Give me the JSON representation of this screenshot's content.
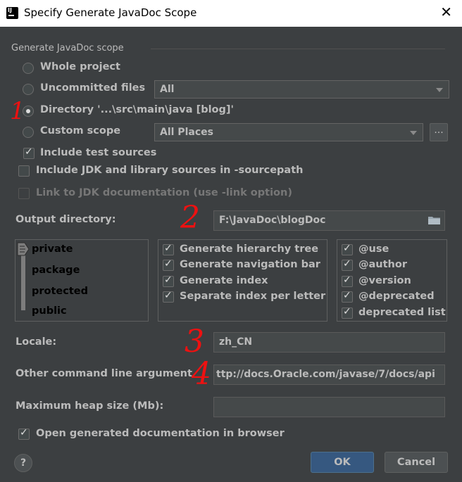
{
  "window": {
    "title": "Specify Generate JavaDoc Scope",
    "close_glyph": "✕"
  },
  "scope": {
    "group_label": "Generate JavaDoc scope",
    "options": [
      {
        "label": "Whole project",
        "checked": false
      },
      {
        "label": "Uncommitted files",
        "checked": false
      },
      {
        "label": "Directory '...\\src\\main\\java [blog]'",
        "checked": true
      },
      {
        "label": "Custom scope",
        "checked": false
      }
    ],
    "uncommitted_combo": "All",
    "custom_scope_combo": "All Places",
    "custom_scope_more": "...",
    "include_test_sources": "Include test sources",
    "include_jdk": "Include JDK and library sources in -sourcepath",
    "link_jdk": "Link to JDK documentation (use -link option)"
  },
  "output": {
    "label": "Output directory:",
    "value": "F:\\JavaDoc\\blogDoc"
  },
  "visibility": {
    "levels": [
      "private",
      "package",
      "protected",
      "public"
    ],
    "selected": "private"
  },
  "generate_options": [
    {
      "label": "Generate hierarchy tree",
      "checked": true
    },
    {
      "label": "Generate navigation bar",
      "checked": true
    },
    {
      "label": "Generate index",
      "checked": true
    },
    {
      "label": "Separate index per letter",
      "checked": true
    }
  ],
  "tag_options": [
    {
      "label": "@use",
      "checked": true
    },
    {
      "label": "@author",
      "checked": true
    },
    {
      "label": "@version",
      "checked": true
    },
    {
      "label": "@deprecated",
      "checked": true
    },
    {
      "label": "deprecated list",
      "checked": true
    }
  ],
  "locale": {
    "label": "Locale:",
    "value": "zh_CN"
  },
  "other_args": {
    "label": "Other command line argument",
    "value": "ttp://docs.Oracle.com/javase/7/docs/api"
  },
  "heap": {
    "label": "Maximum heap size (Mb):",
    "value": ""
  },
  "open_browser": "Open generated documentation in browser",
  "buttons": {
    "ok": "OK",
    "cancel": "Cancel",
    "help": "?"
  },
  "annotations": [
    "1",
    "2",
    "3",
    "4"
  ]
}
